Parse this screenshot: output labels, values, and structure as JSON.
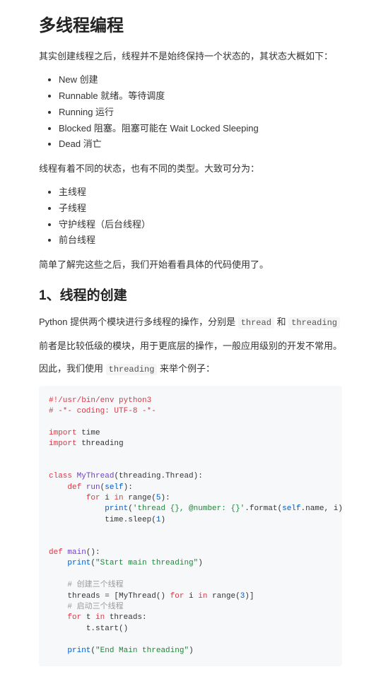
{
  "title": "多线程编程",
  "intro": "其实创建线程之后，线程并不是始终保持一个状态的，其状态大概如下：",
  "states": [
    "New 创建",
    "Runnable 就绪。等待调度",
    "Running 运行",
    "Blocked 阻塞。阻塞可能在 Wait Locked Sleeping",
    "Dead 消亡"
  ],
  "types_intro": "线程有着不同的状态，也有不同的类型。大致可分为：",
  "types": [
    "主线程",
    "子线程",
    "守护线程（后台线程）",
    "前台线程"
  ],
  "after_types": "简单了解完这些之后，我们开始看看具体的代码使用了。",
  "section1_title": "1、线程的创建",
  "p1_prefix": "Python 提供两个模块进行多线程的操作，分别是 ",
  "p1_code1": "thread",
  "p1_mid": " 和 ",
  "p1_code2": "threading",
  "p2": "前者是比较低级的模块，用于更底层的操作，一般应用级别的开发不常用。",
  "p3_prefix": "因此，我们使用 ",
  "p3_code": "threading",
  "p3_suffix": " 来举个例子：",
  "code": {
    "l1": "#!/usr/bin/env python3",
    "l2": "# -*- coding: UTF-8 -*-",
    "l3_kw": "import",
    "l3_mod": " time",
    "l4_kw": "import",
    "l4_mod": " threading",
    "l5_kw": "class",
    "l5_name": " MyThread",
    "l5_args": "(threading.Thread):",
    "l6_kw": "def",
    "l6_name": " run",
    "l6_p1": "(",
    "l6_self": "self",
    "l6_p2": "):",
    "l7_for": "for",
    "l7_i": " i ",
    "l7_in": "in",
    "l7_range": " range",
    "l7_p1": "(",
    "l7_num": "5",
    "l7_p2": "):",
    "l8_print": "print",
    "l8_p1": "(",
    "l8_str": "'thread {}, @number: {}'",
    "l8_fmt": ".format(",
    "l8_self": "self",
    "l8_rest": ".name, i))",
    "l9_a": "time.sleep(",
    "l9_num": "1",
    "l9_b": ")",
    "l10_kw": "def",
    "l10_name": " main",
    "l10_rest": "():",
    "l11_print": "print",
    "l11_p1": "(",
    "l11_str": "\"Start main threading\"",
    "l11_p2": ")",
    "l12": "# 创建三个线程",
    "l13_a": "threads = [MyThread() ",
    "l13_for": "for",
    "l13_i": " i ",
    "l13_in": "in",
    "l13_range": " range",
    "l13_p1": "(",
    "l13_num": "3",
    "l13_p2": ")]",
    "l14": "# 启动三个线程",
    "l15_for": "for",
    "l15_t": " t ",
    "l15_in": "in",
    "l15_rest": " threads:",
    "l16": "t.start()",
    "l17_print": "print",
    "l17_p1": "(",
    "l17_str": "\"End Main threading\"",
    "l17_p2": ")"
  }
}
